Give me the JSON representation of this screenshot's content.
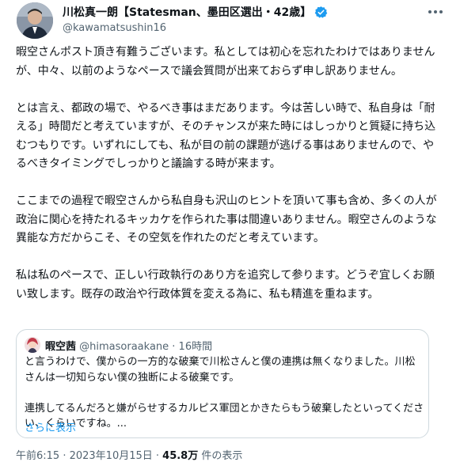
{
  "author": {
    "name": "川松真一朗【Statesman、墨田区選出・42歳】",
    "handle": "@kawamatsushin16",
    "verified_color": "#1d9bf0",
    "more_icon": "more-dots-icon"
  },
  "tweet": {
    "paragraphs": [
      "暇空さんポスト頂き有難うございます。私としては初心を忘れたわけではありませんが、中々、以前のようなペースで議会質問が出来ておらず申し訳ありません。",
      "とは言え、都政の場で、やるべき事はまだあります。今は苦しい時で、私自身は「耐える」時間だと考えていますが、そのチャンスが来た時にはしっかりと質疑に持ち込むつもりです。いずれにしても、私が目の前の課題が逃げる事はありませんので、やるべきタイミングでしっかりと議論する時が来ます。",
      "ここまでの過程で暇空さんから私自身も沢山のヒントを頂いて事も含め、多くの人が政治に関心を持たれるキッカケを作られた事は間違いありません。暇空さんのような異能な方だからこそ、その空気を作れたのだと考えています。",
      "私は私のペースで、正しい行政執行のあり方を追究して参ります。どうぞ宜しくお願い致します。既存の政治や行政体質を変える為に、私も精進を重ねます。"
    ]
  },
  "quote": {
    "name": "暇空茜",
    "meta": "@himasoraakane · 16時間",
    "paragraphs": [
      "と言うわけで、僕からの一方的な破棄で川松さんと僕の連携は無くなりました。川松さんは一切知らない僕の独断による破棄です。",
      "連携してるんだろと嫌がらせするカルピス軍団とかきたらもう破棄したといってください、くらいですね。..."
    ],
    "show_more": "さらに表示"
  },
  "footer": {
    "time": "午前6:15 · 2023年10月15日 · ",
    "views": "45.8万",
    "views_suffix": " 件の表示"
  }
}
